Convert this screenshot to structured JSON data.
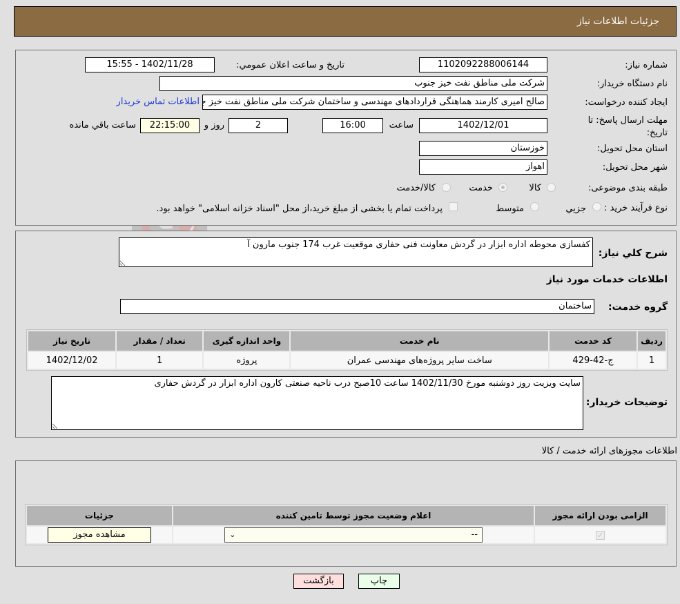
{
  "header": {
    "title": "جزئیات اطلاعات نیاز"
  },
  "details": {
    "need_number_label": "شماره نیاز:",
    "need_number": "1102092288006144",
    "announce_label": "تاریخ و ساعت اعلان عمومي:",
    "announce_value": "1402/11/28 - 15:55",
    "buyer_org_label": "نام دستگاه خريدار:",
    "buyer_org": "شرکت ملی مناطق نفت خیز جنوب",
    "creator_label": "ایجاد کننده درخواست:",
    "creator": "صالح امیری کارمند هماهنگی قراردادهای مهندسی و ساختمان شرکت ملی مناطق نفت خیز جنوب",
    "contact_link": "اطلاعات تماس خريدار",
    "deadline_label": "مهلت ارسال پاسخ: تا تاریخ:",
    "deadline_date": "1402/12/01",
    "time_label": "ساعت",
    "deadline_time": "16:00",
    "days_value": "2",
    "days_label": "روز و",
    "remaining_time": "22:15:00",
    "remaining_label": "ساعت باقي مانده",
    "province_label": "استان محل تحویل:",
    "province": "خوزستان",
    "city_label": "شهر محل تحویل:",
    "city": "اهواز",
    "category_label": "طبقه بندی موضوعی:",
    "category_options": [
      {
        "label": "کالا",
        "checked": false
      },
      {
        "label": "خدمت",
        "checked": true
      },
      {
        "label": "کالا/خدمت",
        "checked": false
      }
    ],
    "process_label": "نوع فرآیند خرید :",
    "process_options": [
      {
        "label": "جزيي",
        "checked": false
      },
      {
        "label": "متوسط",
        "checked": false
      }
    ],
    "treasury_note": "پرداخت تمام یا بخشی از مبلغ خرید،از محل \"اسناد خزانه اسلامی\" خواهد بود."
  },
  "services": {
    "summary_label": "شرح کلي نياز:",
    "summary": "کفسازی محوطه اداره ابزار در گردش معاونت فنی حفاری موقعیت غرب 174 جنوب مارون آ",
    "section_title": "اطلاعات خدمات مورد نياز",
    "group_label": "گروه خدمت:",
    "group_value": "ساختمان",
    "table": {
      "headers": [
        "رديف",
        "کد خدمت",
        "نام خدمت",
        "واحد اندازه گیری",
        "تعداد / مقدار",
        "تاريخ نياز"
      ],
      "rows": [
        [
          "1",
          "ج-42-429",
          "ساخت سایر پروژه‌های مهندسی عمران",
          "پروژه",
          "1",
          "1402/12/02"
        ]
      ]
    },
    "buyer_notes_label": "توضيحات خريدار:",
    "buyer_notes": "سایت ویزیت روز دوشنبه مورخ 1402/11/30 ساعت 10صبح درب ناحیه صنعتی کارون اداره ابزار در گردش حفاری"
  },
  "permits": {
    "section_title": "اطلاعات مجوزهای ارائه خدمت / کالا",
    "headers": [
      "الزامی بودن ارائه مجوز",
      "اعلام وضعیت مجوز توسط تامین کننده",
      "جزئیات"
    ],
    "row": {
      "required_checked": true,
      "status_selected": "--",
      "details_button": "مشاهده مجوز"
    }
  },
  "footer": {
    "print_button": "چاپ",
    "back_button": "بازگشت"
  },
  "colors": {
    "header_bg": "#8b6c42",
    "link": "#1a35d6",
    "print_bg": "#eaffea",
    "back_bg": "#ffdede"
  }
}
